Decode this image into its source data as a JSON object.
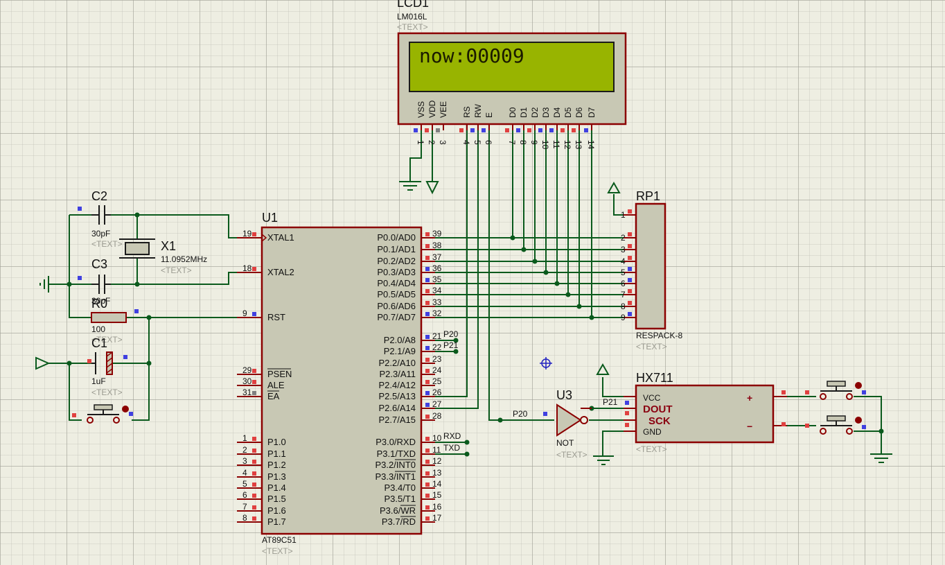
{
  "colors": {
    "wire": "#0a5a1c",
    "body": "#8b0000",
    "fill": "#c8c8b4",
    "lcd": "#98b400",
    "pin_red": "#e04040",
    "pin_blue": "#4040e0"
  },
  "lcd": {
    "ref": "LCD1",
    "model": "LM016L",
    "text_tag": "<TEXT>",
    "display": "now:00009",
    "pin_labels": [
      "VSS",
      "VDD",
      "VEE",
      "RS",
      "RW",
      "E",
      "D0",
      "D1",
      "D2",
      "D3",
      "D4",
      "D5",
      "D6",
      "D7"
    ],
    "pin_numbers": [
      "1",
      "2",
      "3",
      "4",
      "5",
      "6",
      "7",
      "8",
      "9",
      "10",
      "11",
      "12",
      "13",
      "14"
    ]
  },
  "u1": {
    "ref": "U1",
    "model": "AT89C51",
    "text_tag": "<TEXT>",
    "left_pins": [
      {
        "num": "19",
        "label": "XTAL1"
      },
      {
        "num": "18",
        "label": "XTAL2"
      },
      {
        "num": "9",
        "label": "RST"
      },
      {
        "num": "29",
        "label": "PSEN"
      },
      {
        "num": "30",
        "label": "ALE"
      },
      {
        "num": "31",
        "label": "EA"
      },
      {
        "num": "1",
        "label": "P1.0"
      },
      {
        "num": "2",
        "label": "P1.1"
      },
      {
        "num": "3",
        "label": "P1.2"
      },
      {
        "num": "4",
        "label": "P1.3"
      },
      {
        "num": "5",
        "label": "P1.4"
      },
      {
        "num": "6",
        "label": "P1.5"
      },
      {
        "num": "7",
        "label": "P1.6"
      },
      {
        "num": "8",
        "label": "P1.7"
      }
    ],
    "right_pins": [
      {
        "num": "39",
        "label": "P0.0/AD0"
      },
      {
        "num": "38",
        "label": "P0.1/AD1"
      },
      {
        "num": "37",
        "label": "P0.2/AD2"
      },
      {
        "num": "36",
        "label": "P0.3/AD3"
      },
      {
        "num": "35",
        "label": "P0.4/AD4"
      },
      {
        "num": "34",
        "label": "P0.5/AD5"
      },
      {
        "num": "33",
        "label": "P0.6/AD6"
      },
      {
        "num": "32",
        "label": "P0.7/AD7"
      },
      {
        "num": "21",
        "label": "P2.0/A8"
      },
      {
        "num": "22",
        "label": "P2.1/A9"
      },
      {
        "num": "23",
        "label": "P2.2/A10"
      },
      {
        "num": "24",
        "label": "P2.3/A11"
      },
      {
        "num": "25",
        "label": "P2.4/A12"
      },
      {
        "num": "26",
        "label": "P2.5/A13"
      },
      {
        "num": "27",
        "label": "P2.6/A14"
      },
      {
        "num": "28",
        "label": "P2.7/A15"
      },
      {
        "num": "10",
        "label": "P3.0/RXD"
      },
      {
        "num": "11",
        "label": "P3.1/TXD"
      },
      {
        "num": "12",
        "label": "P3.2/INT0"
      },
      {
        "num": "13",
        "label": "P3.3/INT1"
      },
      {
        "num": "14",
        "label": "P3.4/T0"
      },
      {
        "num": "15",
        "label": "P3.5/T1"
      },
      {
        "num": "16",
        "label": "P3.6/WR"
      },
      {
        "num": "17",
        "label": "P3.7/RD"
      }
    ],
    "net_labels": {
      "p20": "P20",
      "p21": "P21",
      "rxd": "RXD",
      "txd": "TXD"
    }
  },
  "c2": {
    "ref": "C2",
    "value": "30pF",
    "text_tag": "<TEXT>"
  },
  "c3": {
    "ref": "C3",
    "value": "30pF",
    "text_tag": "<TEXT>"
  },
  "x1": {
    "ref": "X1",
    "value": "11.0952MHz",
    "text_tag": "<TEXT>"
  },
  "r0": {
    "ref": "R0",
    "value": "100",
    "text_tag": "<TEXT>"
  },
  "c1": {
    "ref": "C1",
    "value": "1uF",
    "text_tag": "<TEXT>"
  },
  "rp1": {
    "ref": "RP1",
    "model": "RESPACK-8",
    "text_tag": "<TEXT>",
    "pins": [
      "1",
      "2",
      "3",
      "4",
      "5",
      "6",
      "7",
      "8",
      "9"
    ]
  },
  "u3": {
    "ref": "U3",
    "model": "NOT",
    "text_tag": "<TEXT>",
    "in_label": "P20",
    "out_label": "P21"
  },
  "hx711": {
    "ref": "HX711",
    "text_tag": "<TEXT>",
    "pins": [
      "VCC",
      "DOUT",
      "SCK",
      "GND"
    ],
    "plus": "+",
    "minus": "−"
  }
}
